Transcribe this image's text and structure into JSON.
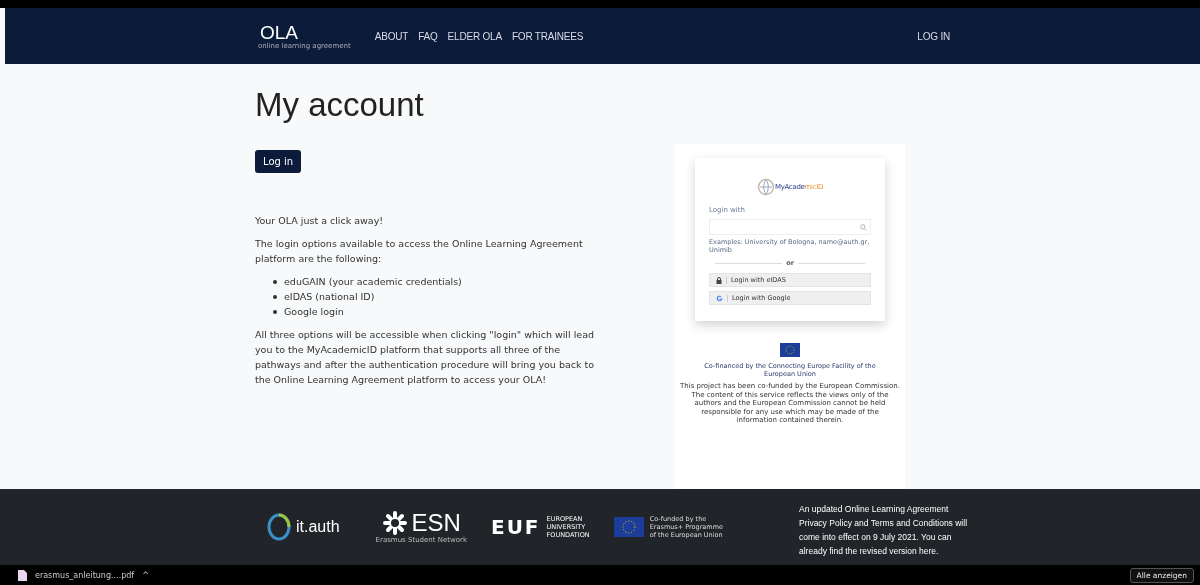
{
  "nav": {
    "logo": "OLA",
    "logo_subtitle": "online learning agreement",
    "links": [
      "ABOUT",
      "FAQ",
      "ELDER OLA",
      "FOR TRAINEES"
    ],
    "login": "LOG IN"
  },
  "main": {
    "title": "My account",
    "login_button": "Log in",
    "intro": "Your OLA just a click away!",
    "options_text": "The login options available to access the Online Learning Agreement platform are the following:",
    "options": [
      "eduGAIN (your academic credentials)",
      "eIDAS (national ID)",
      "Google login"
    ],
    "closing": "All three options will be accessible when clicking \"login\" which will lead you to the MyAcademicID platform that supports all three of the pathways and after the authentication procedure will bring you back to the Online Learning Agreement platform to access your OLA!"
  },
  "preview": {
    "brand_a": "MyAcade",
    "brand_b": "mic",
    "brand_c": "ID",
    "login_with": "Login with",
    "examples": "Examples: University of Bologna, name@auth.gr, Unimib",
    "or": "or",
    "buttons": [
      {
        "kind": "eidas",
        "label": "Login with eIDAS"
      },
      {
        "kind": "google",
        "label": "Login with Google"
      }
    ],
    "cofinanced": "Co-financed by the Connecting Europe Facility of the European Union",
    "disclaimer": "This project has been co-funded by the European Commission. The content of this service reflects the views only of the authors and the European Commission cannot be held responsible for any use which may be made of the information contained therein."
  },
  "footer": {
    "itauth": "it.auth",
    "esn": "ESN",
    "esn_sub": "Erasmus Student Network",
    "euf": "EUF",
    "euf_sub": [
      "EUROPEAN",
      "UNIVERSITY",
      "FOUNDATION"
    ],
    "eu_text": [
      "Co-funded by the",
      "Erasmus+ Programme",
      "of the European Union"
    ],
    "notice": "An updated Online Learning Agreement Privacy Policy and Terms and Conditions will come into effect on 9 July 2021. You can already find the revised version here."
  },
  "downloads": {
    "file": "erasmus_anleitung....pdf",
    "caret": "^",
    "show_all": "Alle anzeigen"
  }
}
